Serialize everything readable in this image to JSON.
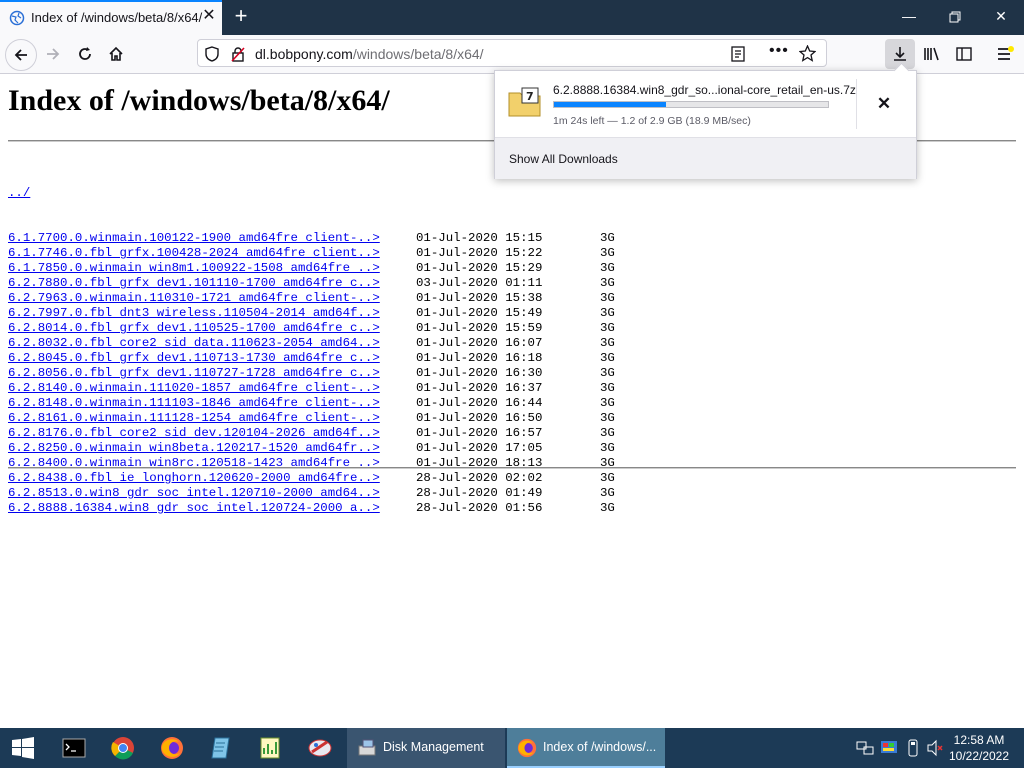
{
  "browser": {
    "tab_title": "Index of /windows/beta/8/x64/",
    "url_domain": "dl.bobpony.com",
    "url_prefix": "",
    "url_path": "/windows/beta/8/x64/"
  },
  "page": {
    "heading": "Index of /windows/beta/8/x64/",
    "parent_link": "../",
    "rows": [
      {
        "name": "6.1.7700.0.winmain.100122-1900 amd64fre client-..>",
        "date": "01-Jul-2020 15:15",
        "size": "3G"
      },
      {
        "name": "6.1.7746.0.fbl grfx.100428-2024 amd64fre client..>",
        "date": "01-Jul-2020 15:22",
        "size": "3G"
      },
      {
        "name": "6.1.7850.0.winmain win8m1.100922-1508 amd64fre ..>",
        "date": "01-Jul-2020 15:29",
        "size": "3G"
      },
      {
        "name": "6.2.7880.0.fbl grfx dev1.101110-1700 amd64fre c..>",
        "date": "03-Jul-2020 01:11",
        "size": "3G"
      },
      {
        "name": "6.2.7963.0.winmain.110310-1721 amd64fre client-..>",
        "date": "01-Jul-2020 15:38",
        "size": "3G"
      },
      {
        "name": "6.2.7997.0.fbl dnt3 wireless.110504-2014 amd64f..>",
        "date": "01-Jul-2020 15:49",
        "size": "3G"
      },
      {
        "name": "6.2.8014.0.fbl grfx dev1.110525-1700 amd64fre c..>",
        "date": "01-Jul-2020 15:59",
        "size": "3G"
      },
      {
        "name": "6.2.8032.0.fbl core2 sid data.110623-2054 amd64..>",
        "date": "01-Jul-2020 16:07",
        "size": "3G"
      },
      {
        "name": "6.2.8045.0.fbl grfx dev1.110713-1730 amd64fre c..>",
        "date": "01-Jul-2020 16:18",
        "size": "3G"
      },
      {
        "name": "6.2.8056.0.fbl grfx dev1.110727-1728 amd64fre c..>",
        "date": "01-Jul-2020 16:30",
        "size": "3G"
      },
      {
        "name": "6.2.8140.0.winmain.111020-1857 amd64fre client-..>",
        "date": "01-Jul-2020 16:37",
        "size": "3G"
      },
      {
        "name": "6.2.8148.0.winmain.111103-1846 amd64fre client-..>",
        "date": "01-Jul-2020 16:44",
        "size": "3G"
      },
      {
        "name": "6.2.8161.0.winmain.111128-1254 amd64fre client-..>",
        "date": "01-Jul-2020 16:50",
        "size": "3G"
      },
      {
        "name": "6.2.8176.0.fbl core2 sid dev.120104-2026 amd64f..>",
        "date": "01-Jul-2020 16:57",
        "size": "3G"
      },
      {
        "name": "6.2.8250.0.winmain win8beta.120217-1520 amd64fr..>",
        "date": "01-Jul-2020 17:05",
        "size": "3G"
      },
      {
        "name": "6.2.8400.0.winmain win8rc.120518-1423 amd64fre ..>",
        "date": "01-Jul-2020 18:13",
        "size": "3G"
      },
      {
        "name": "6.2.8438.0.fbl ie longhorn.120620-2000 amd64fre..>",
        "date": "28-Jul-2020 02:02",
        "size": "3G"
      },
      {
        "name": "6.2.8513.0.win8 gdr soc intel.120710-2000 amd64..>",
        "date": "28-Jul-2020 01:49",
        "size": "3G"
      },
      {
        "name": "6.2.8888.16384.win8 gdr soc intel.120724-2000 a..>",
        "date": "28-Jul-2020 01:56",
        "size": "3G"
      }
    ]
  },
  "download": {
    "filename": "6.2.8888.16384.win8_gdr_so...ional-core_retail_en-us.7z",
    "status": "1m 24s left — 1.2 of 2.9 GB (18.9 MB/sec)",
    "progress_fraction": 0.41,
    "show_all_label": "Show All Downloads",
    "cancel_glyph": "✕"
  },
  "taskbar": {
    "tasks": [
      {
        "label": "Disk Management"
      },
      {
        "label": "Index of /windows/..."
      }
    ],
    "time": "12:58 AM",
    "date": "10/22/2022"
  },
  "colors": {
    "accent": "#0a84ff",
    "titlebar": "#1f3347",
    "taskbar": "#1c3a56",
    "link": "#0000ee"
  }
}
